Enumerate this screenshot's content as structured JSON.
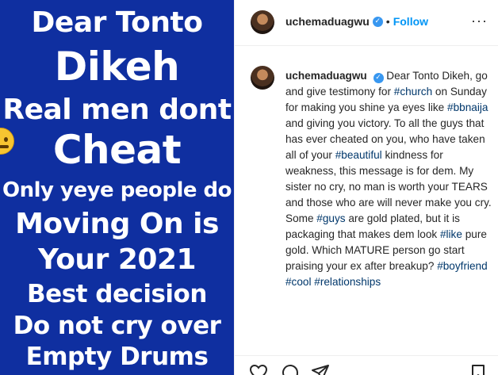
{
  "image": {
    "lines": [
      "Dear Tonto",
      "Dikeh",
      "Real men dont",
      "Cheat",
      "Only yeye people do",
      "Moving On is",
      "Your 2021",
      "Best decision",
      "Do not cry over",
      "Empty Drums"
    ],
    "background_color": "#0f2fa0"
  },
  "header": {
    "username": "uchemaduagwu",
    "separator": "•",
    "follow_label": "Follow",
    "more_glyph": "···"
  },
  "caption": {
    "username": "uchemaduagwu",
    "segments": [
      {
        "t": "Dear Tonto Dikeh, go and give testimony for "
      },
      {
        "tag": "#church"
      },
      {
        "t": " on Sunday for making you shine ya eyes like "
      },
      {
        "tag": "#bbnaija"
      },
      {
        "t": " and giving you victory. To all the guys that has ever cheated on you, who have taken all of your "
      },
      {
        "tag": "#beautiful"
      },
      {
        "t": " kindness for weakness, this message is for dem. My sister no cry, no man is worth your TEARS and those who are will never make you cry. Some "
      },
      {
        "tag": "#guys"
      },
      {
        "t": " are gold plated, but it is packaging that makes dem look "
      },
      {
        "tag": "#like"
      },
      {
        "t": " pure gold. Which MATURE person go start praising your ex after breakup? "
      },
      {
        "tag": "#boyfriend"
      },
      {
        "t": " "
      },
      {
        "tag": "#cool"
      },
      {
        "t": " "
      },
      {
        "tag": "#relationships"
      }
    ]
  },
  "actions": {
    "icons": [
      "heart-icon",
      "comment-icon",
      "share-icon",
      "bookmark-icon"
    ]
  },
  "colors": {
    "accent": "#0095f6",
    "hashtag": "#00376b",
    "verified": "#3897f0",
    "text": "#262626"
  }
}
